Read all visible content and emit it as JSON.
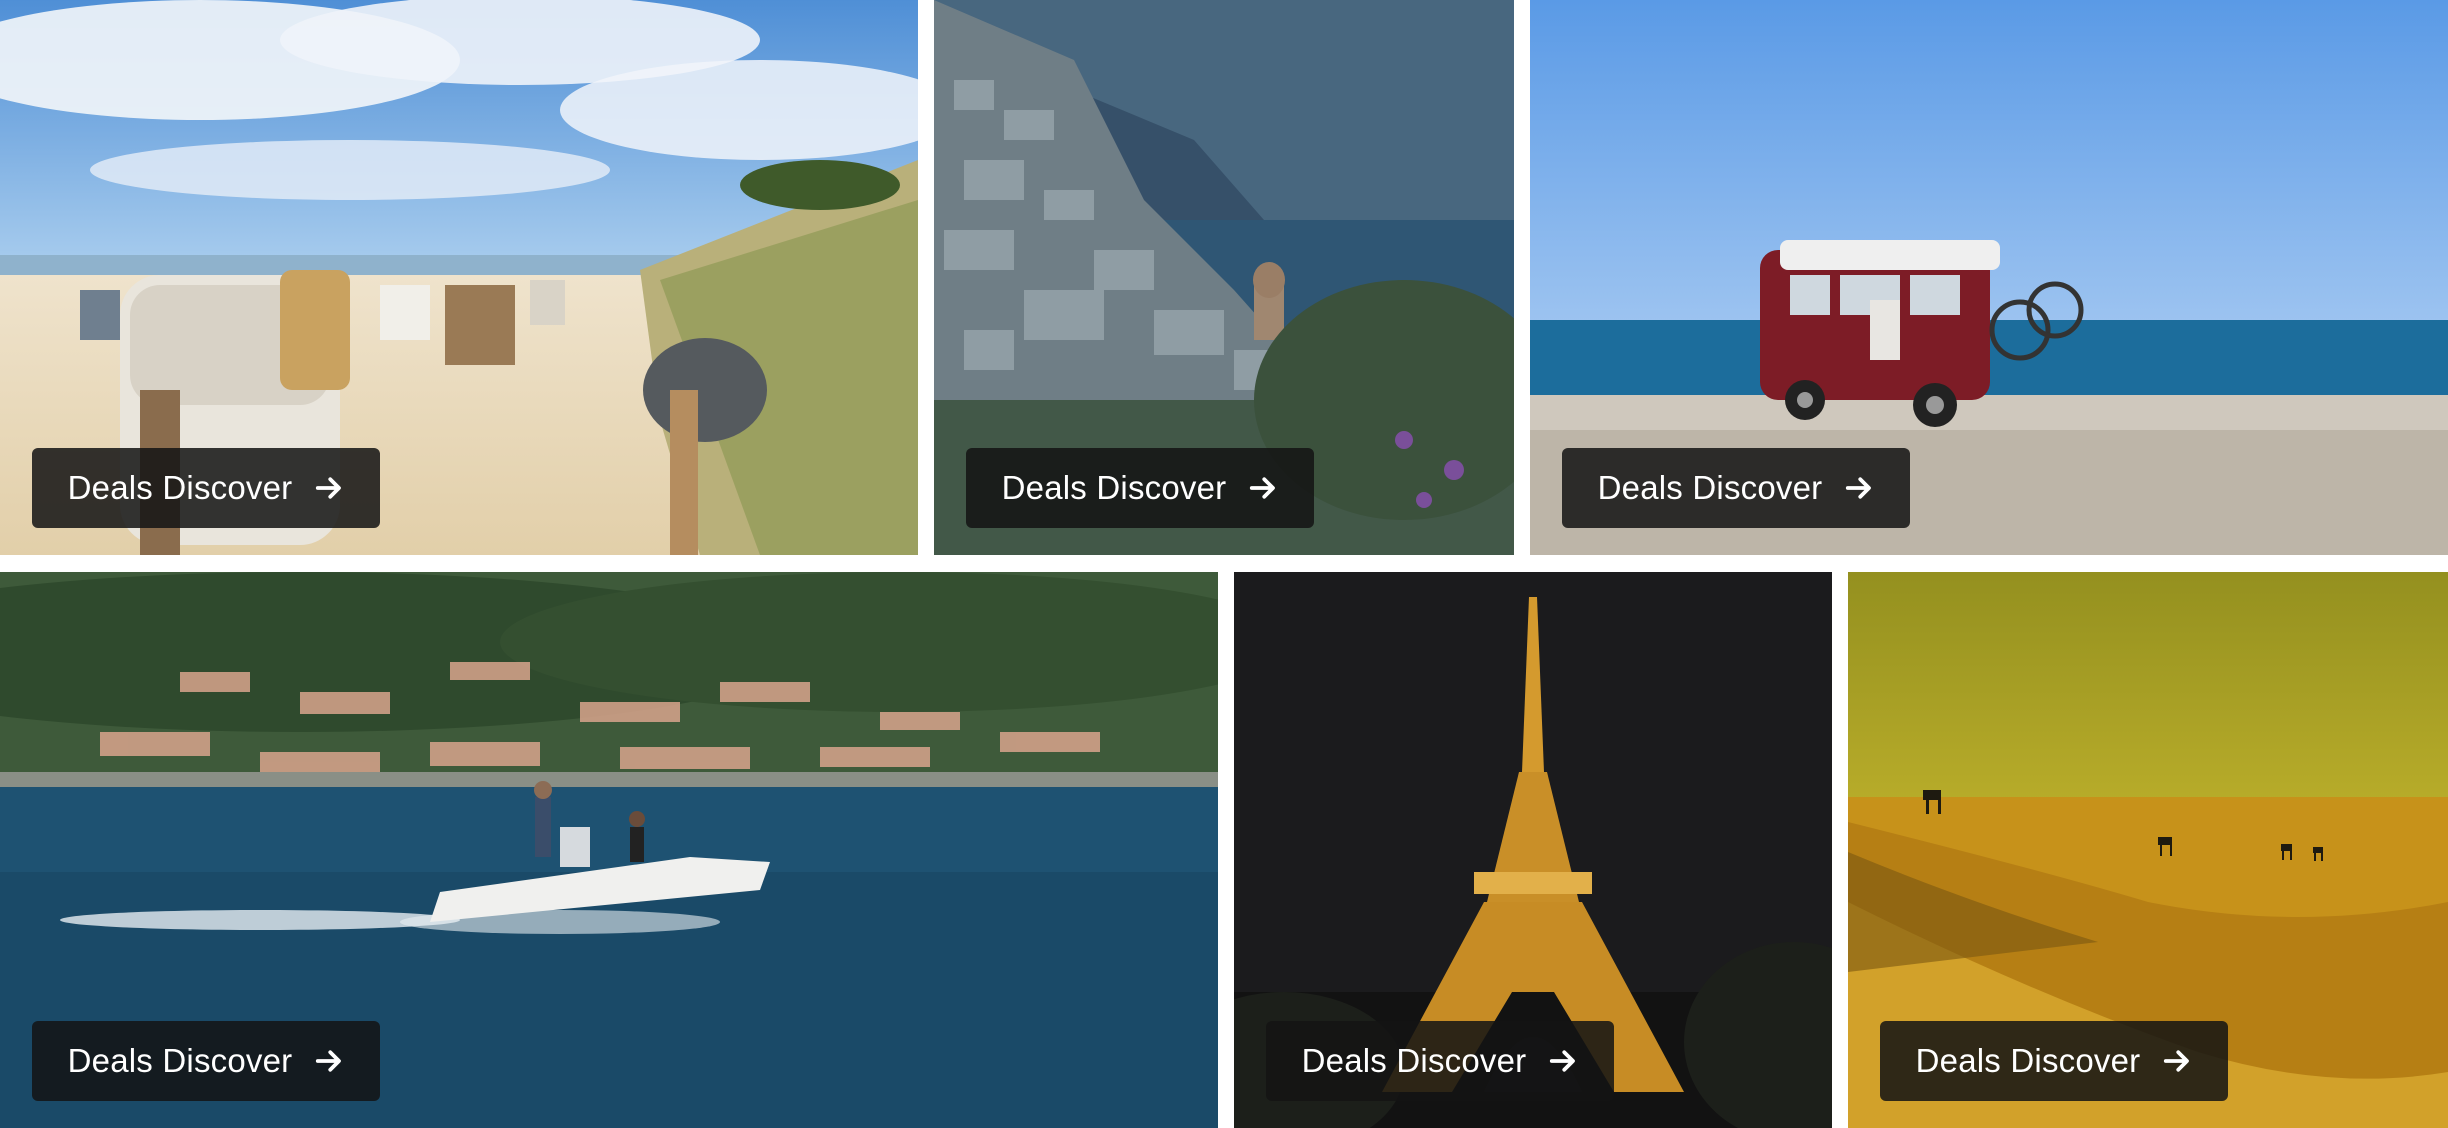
{
  "tiles": [
    {
      "image": "beach-with-wicker-chairs",
      "cta_label": "Deals Discover",
      "cta_icon": "arrow-right-icon"
    },
    {
      "image": "cliffside-coastal-village",
      "cta_label": "Deals Discover",
      "cta_icon": "arrow-right-icon"
    },
    {
      "image": "red-van-by-sea",
      "cta_label": "Deals Discover",
      "cta_icon": "arrow-right-icon"
    },
    {
      "image": "speedboat-on-lake",
      "cta_label": "Deals Discover",
      "cta_icon": "arrow-right-icon"
    },
    {
      "image": "eiffel-tower-night",
      "cta_label": "Deals Discover",
      "cta_icon": "arrow-right-icon"
    },
    {
      "image": "desert-dunes-camels",
      "cta_label": "Deals Discover",
      "cta_icon": "arrow-right-icon"
    }
  ],
  "colors": {
    "button_bg": "#141414",
    "button_text": "#ffffff",
    "page_bg": "#ffffff"
  }
}
